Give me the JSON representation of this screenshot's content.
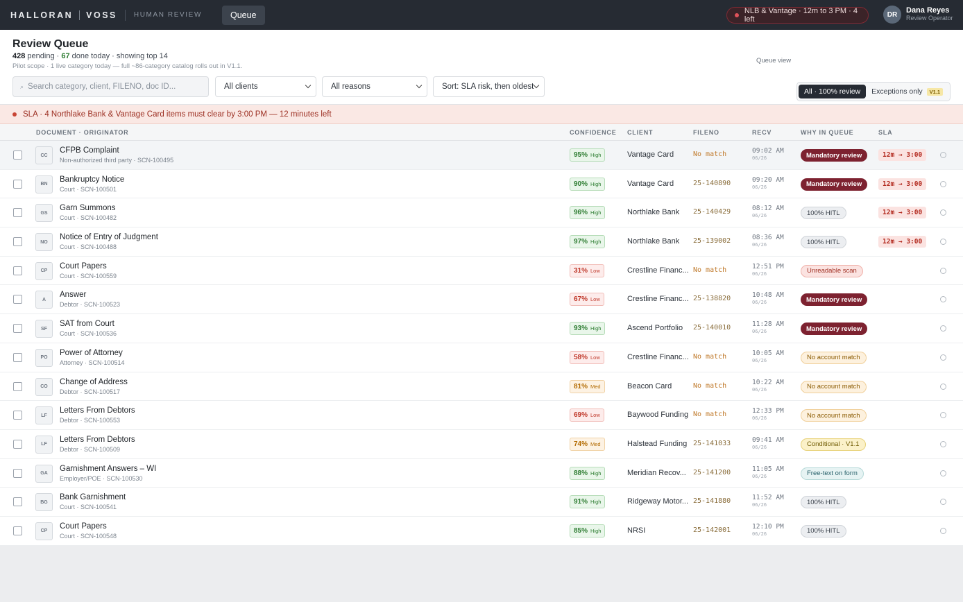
{
  "topbar": {
    "brand_left": "HALLORAN",
    "brand_right": "VOSS",
    "brand_sub": "HUMAN REVIEW",
    "nav_tab": "Queue",
    "sla_pill": "NLB & Vantage · 12m to 3 PM · 4 left",
    "user_initials": "DR",
    "user_name": "Dana Reyes",
    "user_role": "Review Operator"
  },
  "header": {
    "title": "Review Queue",
    "pending_count": "428",
    "pending_label": " pending · ",
    "done_count": "67",
    "done_label": " done today · showing top 14",
    "scope": "Pilot scope · 1 live category today — full ~86-category catalog rolls out in V1.1.",
    "queue_view_label": "Queue view",
    "toggle_all": "All · 100% review",
    "toggle_exceptions": "Exceptions only",
    "toggle_badge": "V1.1"
  },
  "filters": {
    "search_placeholder": "Search category, client, FILENO, doc ID...",
    "clients": "All clients",
    "reasons": "All reasons",
    "sort": "Sort: SLA risk, then oldest"
  },
  "banner": "SLA · 4 Northlake Bank & Vantage Card items must clear by 3:00 PM — 12 minutes left",
  "columns": {
    "document": "DOCUMENT · ORIGINATOR",
    "confidence": "CONFIDENCE",
    "client": "CLIENT",
    "fileno": "FILENO",
    "recv": "RECV",
    "why": "WHY IN QUEUE",
    "sla": "SLA"
  },
  "rows": [
    {
      "abbr": "CC",
      "name": "CFPB Complaint",
      "sub": "Non-authorized third party · SCN-100495",
      "conf": "95%",
      "level": "High",
      "client": "Vantage Card",
      "fileno": "No match",
      "recv": "09:02 AM",
      "date": "06/26",
      "why": "Mandatory review",
      "why_type": "mandatory",
      "sla": "12m → 3:00"
    },
    {
      "abbr": "BN",
      "name": "Bankruptcy Notice",
      "sub": "Court · SCN-100501",
      "conf": "90%",
      "level": "High",
      "client": "Vantage Card",
      "fileno": "25-140890",
      "recv": "09:20 AM",
      "date": "06/26",
      "why": "Mandatory review",
      "why_type": "mandatory",
      "sla": "12m → 3:00"
    },
    {
      "abbr": "GS",
      "name": "Garn Summons",
      "sub": "Court · SCN-100482",
      "conf": "96%",
      "level": "High",
      "client": "Northlake Bank",
      "fileno": "25-140429",
      "recv": "08:12 AM",
      "date": "06/26",
      "why": "100% HITL",
      "why_type": "hitl",
      "sla": "12m → 3:00"
    },
    {
      "abbr": "NO",
      "name": "Notice of Entry of Judgment",
      "sub": "Court · SCN-100488",
      "conf": "97%",
      "level": "High",
      "client": "Northlake Bank",
      "fileno": "25-139002",
      "recv": "08:36 AM",
      "date": "06/26",
      "why": "100% HITL",
      "why_type": "hitl",
      "sla": "12m → 3:00"
    },
    {
      "abbr": "CP",
      "name": "Court Papers",
      "sub": "Court · SCN-100559",
      "conf": "31%",
      "level": "Low",
      "client": "Crestline Financ...",
      "fileno": "No match",
      "recv": "12:51 PM",
      "date": "06/26",
      "why": "Unreadable scan",
      "why_type": "unread",
      "sla": ""
    },
    {
      "abbr": "A",
      "name": "Answer",
      "sub": "Debtor · SCN-100523",
      "conf": "67%",
      "level": "Low",
      "client": "Crestline Financ...",
      "fileno": "25-138820",
      "recv": "10:48 AM",
      "date": "06/26",
      "why": "Mandatory review",
      "why_type": "mandatory",
      "sla": ""
    },
    {
      "abbr": "SF",
      "name": "SAT from Court",
      "sub": "Court · SCN-100536",
      "conf": "93%",
      "level": "High",
      "client": "Ascend Portfolio",
      "fileno": "25-140010",
      "recv": "11:28 AM",
      "date": "06/26",
      "why": "Mandatory review",
      "why_type": "mandatory",
      "sla": ""
    },
    {
      "abbr": "PO",
      "name": "Power of Attorney",
      "sub": "Attorney · SCN-100514",
      "conf": "58%",
      "level": "Low",
      "client": "Crestline Financ...",
      "fileno": "No match",
      "recv": "10:05 AM",
      "date": "06/26",
      "why": "No account match",
      "why_type": "noacct",
      "sla": ""
    },
    {
      "abbr": "CO",
      "name": "Change of Address",
      "sub": "Debtor · SCN-100517",
      "conf": "81%",
      "level": "Med",
      "client": "Beacon Card",
      "fileno": "No match",
      "recv": "10:22 AM",
      "date": "06/26",
      "why": "No account match",
      "why_type": "noacct",
      "sla": ""
    },
    {
      "abbr": "LF",
      "name": "Letters From Debtors",
      "sub": "Debtor · SCN-100553",
      "conf": "69%",
      "level": "Low",
      "client": "Baywood Funding",
      "fileno": "No match",
      "recv": "12:33 PM",
      "date": "06/26",
      "why": "No account match",
      "why_type": "noacct",
      "sla": ""
    },
    {
      "abbr": "LF",
      "name": "Letters From Debtors",
      "sub": "Debtor · SCN-100509",
      "conf": "74%",
      "level": "Med",
      "client": "Halstead Funding",
      "fileno": "25-141033",
      "recv": "09:41 AM",
      "date": "06/26",
      "why": "Conditional · V1.1",
      "why_type": "cond",
      "sla": ""
    },
    {
      "abbr": "GA",
      "name": "Garnishment Answers – WI",
      "sub": "Employer/POE · SCN-100530",
      "conf": "88%",
      "level": "High",
      "client": "Meridian Recov...",
      "fileno": "25-141200",
      "recv": "11:05 AM",
      "date": "06/26",
      "why": "Free-text on form",
      "why_type": "free",
      "sla": ""
    },
    {
      "abbr": "BG",
      "name": "Bank Garnishment",
      "sub": "Court · SCN-100541",
      "conf": "91%",
      "level": "High",
      "client": "Ridgeway Motor...",
      "fileno": "25-141880",
      "recv": "11:52 AM",
      "date": "06/26",
      "why": "100% HITL",
      "why_type": "hitl",
      "sla": ""
    },
    {
      "abbr": "CP",
      "name": "Court Papers",
      "sub": "Court · SCN-100548",
      "conf": "85%",
      "level": "High",
      "client": "NRSI",
      "fileno": "25-142001",
      "recv": "12:10 PM",
      "date": "06/26",
      "why": "100% HITL",
      "why_type": "hitl",
      "sla": ""
    }
  ]
}
